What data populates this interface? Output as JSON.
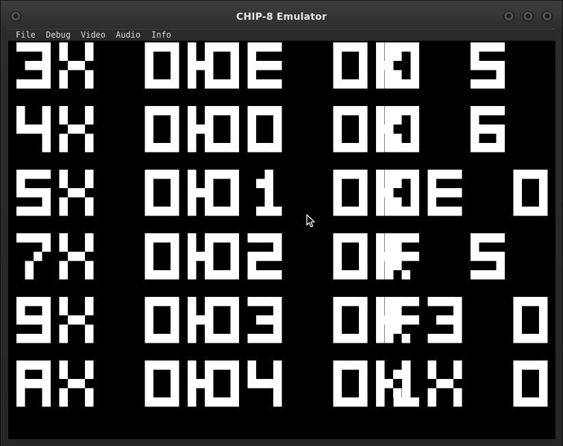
{
  "window": {
    "title": "CHIP-8 Emulator"
  },
  "menu": {
    "items": [
      "File",
      "Debug",
      "Video",
      "Audio",
      "Info"
    ]
  },
  "display": {
    "foreground": "#ffffff",
    "background": "#000000",
    "result_rows": [
      [
        "3X OK",
        "0E OK",
        "0 5 OK"
      ],
      [
        "4X OK",
        "00 OK",
        "0 6 OK"
      ],
      [
        "5X OK",
        "01 OK",
        "0E OK"
      ],
      [
        "7X OK",
        "02 OK",
        "F 5 OK"
      ],
      [
        "9X OK",
        "03 OK",
        "F3 OK"
      ],
      [
        "AX OK",
        "04 OK",
        "1X OK"
      ]
    ]
  },
  "cursor": "arrow-pointer-icon"
}
